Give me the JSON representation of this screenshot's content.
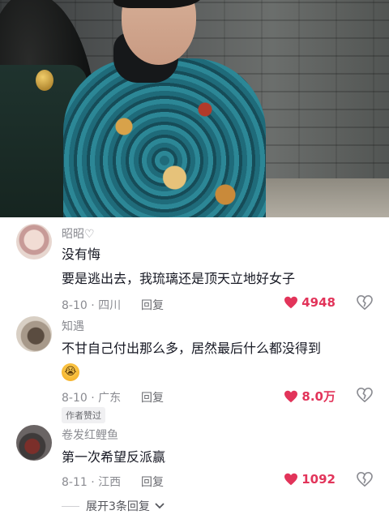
{
  "comments": [
    {
      "author": "昭昭♡",
      "lines": [
        "没有悔",
        "要是逃出去，我琉璃还是顶天立地好女子"
      ],
      "date": "8-10",
      "location": "四川",
      "reply_label": "回复",
      "likes": "4948"
    },
    {
      "author": "知遇",
      "lines": [
        "不甘自己付出那么多，居然最后什么都没得到"
      ],
      "emoji": "crying-face",
      "date": "8-10",
      "location": "广东",
      "reply_label": "回复",
      "likes": "8.0万",
      "badge": "作者赞过"
    },
    {
      "author": "卷发红鲤鱼",
      "lines": [
        "第一次希望反派赢"
      ],
      "date": "8-11",
      "location": "江西",
      "reply_label": "回复",
      "likes": "1092"
    }
  ],
  "expand_replies": "展开3条回复",
  "colors": {
    "like": "#e2345a",
    "meta": "#8a8b91",
    "text": "#161823"
  },
  "icons": {
    "like": "heart-icon",
    "dislike": "broken-heart-icon",
    "expand": "chevron-down-icon"
  }
}
